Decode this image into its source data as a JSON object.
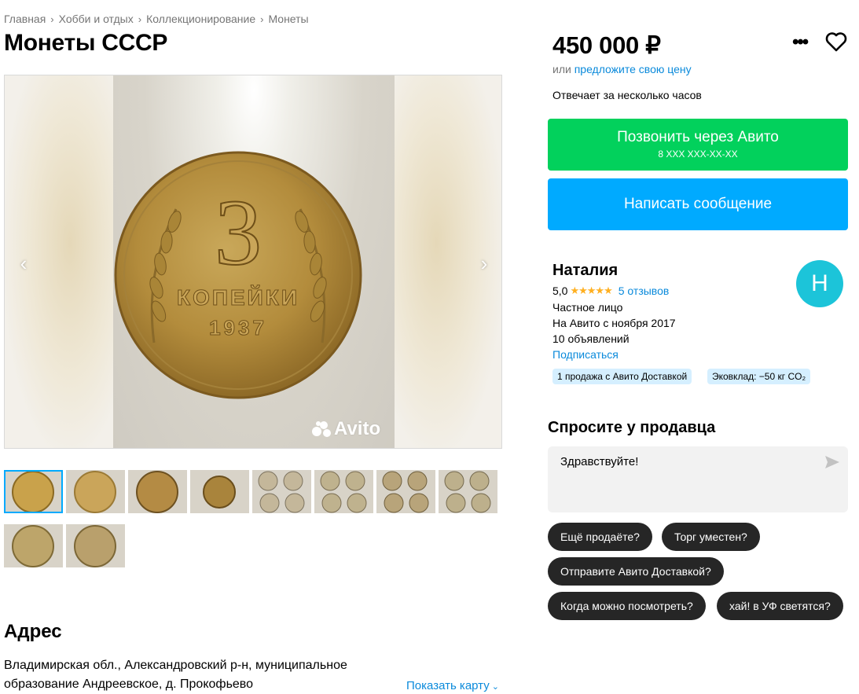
{
  "breadcrumb": [
    "Главная",
    "Хобби и отдых",
    "Коллекционирование",
    "Монеты"
  ],
  "title": "Монеты СССР",
  "gallery": {
    "watermark": "Avito",
    "coin_denomination": "3",
    "coin_word": "КОПЕЙКИ",
    "coin_year": "1937",
    "thumbnails_count": 10
  },
  "address": {
    "title": "Адрес",
    "text": "Владимирская обл., Александровский р-н, муниципальное образование Андреевское, д. Прокофьево",
    "show_map": "Показать карту"
  },
  "price": {
    "value": "450 000 ₽",
    "offer_prefix": "или",
    "offer_link": "предложите свою цену"
  },
  "reply_time": "Отвечает за несколько часов",
  "call_button": {
    "label": "Позвонить через Авито",
    "phone": "8 XXX XXX-XX-XX"
  },
  "message_button": {
    "label": "Написать сообщение"
  },
  "seller": {
    "name": "Наталия",
    "rating": "5,0",
    "reviews": "5 отзывов",
    "type": "Частное лицо",
    "since": "На Авито с ноября 2017",
    "ads": "10 объявлений",
    "subscribe": "Подписаться",
    "badges": [
      "1 продажа с Авито Доставкой",
      "Эковклад: −50 кг CO₂"
    ],
    "avatar_letter": "Н"
  },
  "ask": {
    "title": "Спросите у продавца",
    "message": "Здравствуйте!",
    "chips": [
      "Ещё продаёте?",
      "Торг уместен?",
      "Отправите Авито Доставкой?",
      "Когда можно посмотреть?",
      "хай! в УФ светятся?"
    ]
  },
  "colors": {
    "call": "#02d15c",
    "message": "#00aaff",
    "link": "#0a8adb",
    "avatar": "#1cc4d9",
    "badge": "#d5efff",
    "chip": "#262626"
  }
}
